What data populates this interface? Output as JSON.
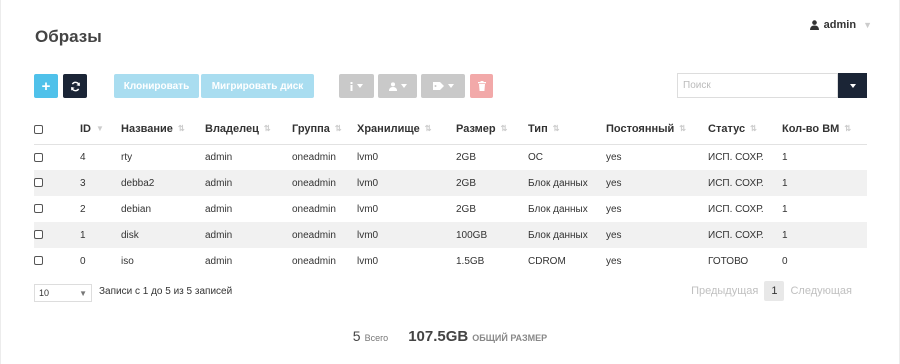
{
  "page": {
    "title": "Образы"
  },
  "user": {
    "name": "admin",
    "icon": "user-icon"
  },
  "toolbar": {
    "add_icon": "+",
    "refresh_icon": "refresh-icon",
    "clone_label": "Клонировать",
    "migrate_label": "Мигрировать диск",
    "info_icon": "info-icon",
    "owner_icon": "user-icon",
    "label_icon": "tag-icon",
    "delete_icon": "trash-icon"
  },
  "search": {
    "placeholder": "Поиск",
    "value": ""
  },
  "table": {
    "headers": [
      "ID",
      "Название",
      "Владелец",
      "Группа",
      "Хранилище",
      "Размер",
      "Тип",
      "Постоянный",
      "Статус",
      "Кол-во ВМ"
    ],
    "rows": [
      [
        "4",
        "rty",
        "admin",
        "oneadmin",
        "lvm0",
        "2GB",
        "ОС",
        "yes",
        "ИСП. СОХР.",
        "1"
      ],
      [
        "3",
        "debba2",
        "admin",
        "oneadmin",
        "lvm0",
        "2GB",
        "Блок данных",
        "yes",
        "ИСП. СОХР.",
        "1"
      ],
      [
        "2",
        "debian",
        "admin",
        "oneadmin",
        "lvm0",
        "2GB",
        "Блок данных",
        "yes",
        "ИСП. СОХР.",
        "1"
      ],
      [
        "1",
        "disk",
        "admin",
        "oneadmin",
        "lvm0",
        "100GB",
        "Блок данных",
        "yes",
        "ИСП. СОХР.",
        "1"
      ],
      [
        "0",
        "iso",
        "admin",
        "oneadmin",
        "lvm0",
        "1.5GB",
        "CDROM",
        "yes",
        "ГОТОВО",
        "0"
      ]
    ]
  },
  "pagination": {
    "page_length": "10",
    "info": "Записи с 1 до 5 из 5 записей",
    "prev": "Предыдущая",
    "current": "1",
    "next": "Следующая"
  },
  "footer": {
    "total_count": "5",
    "total_label": "Всего",
    "total_size": "107.5GB",
    "size_label": "ОБЩИЙ РАЗМЕР"
  },
  "colors": {
    "accent": "#4fc1ea",
    "dark": "#1b2536",
    "danger_light": "#f2a9a9",
    "disabled": "#c9c9c9"
  }
}
